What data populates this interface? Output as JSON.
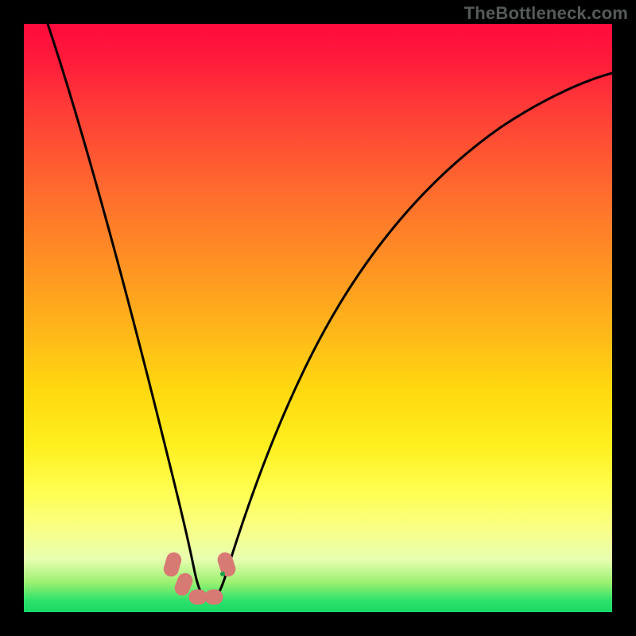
{
  "watermark": "TheBottleneck.com",
  "chart_data": {
    "type": "line",
    "title": "",
    "xlabel": "",
    "ylabel": "",
    "xlim": [
      0,
      100
    ],
    "ylim": [
      0,
      100
    ],
    "series": [
      {
        "name": "bottleneck-curve",
        "x": [
          4,
          8,
          12,
          16,
          20,
          23,
          25,
          27,
          28.5,
          30,
          31.5,
          33,
          37,
          42,
          50,
          60,
          72,
          85,
          100
        ],
        "y": [
          100,
          80,
          62,
          44,
          26,
          14,
          8,
          4,
          3,
          3,
          4,
          7,
          16,
          28,
          44,
          58,
          70,
          78,
          84
        ]
      }
    ],
    "markers": [
      {
        "name": "left-shoulder-top",
        "x": 25,
        "y": 9
      },
      {
        "name": "left-shoulder-mid",
        "x": 26.5,
        "y": 5
      },
      {
        "name": "valley-left",
        "x": 28.5,
        "y": 3
      },
      {
        "name": "valley-right",
        "x": 31.0,
        "y": 3
      },
      {
        "name": "right-shoulder",
        "x": 33.0,
        "y": 8
      }
    ],
    "colors": {
      "curve": "#000000",
      "marker": "#d87a74",
      "background_top": "#ff0b3d",
      "background_bottom": "#18d964"
    }
  }
}
